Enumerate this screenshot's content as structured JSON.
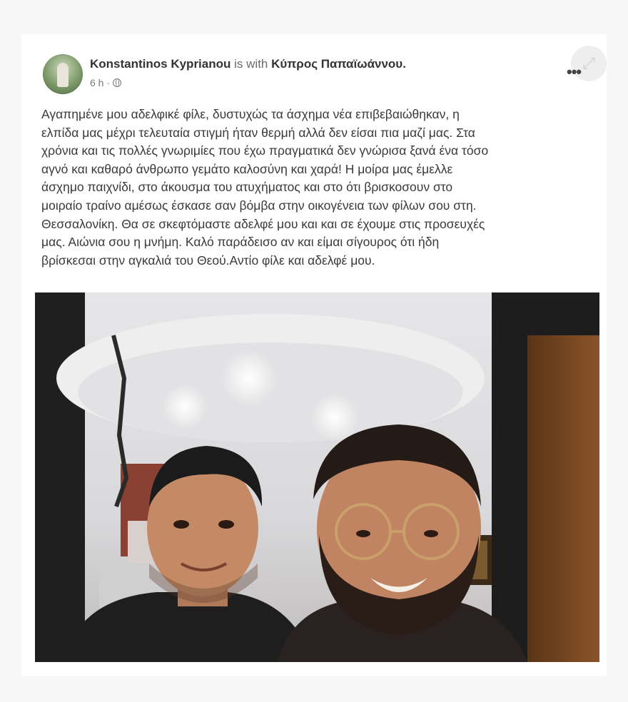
{
  "post": {
    "author": "Konstantinos Kyprianou",
    "with_text": "is with",
    "tagged": "Κύπρος Παπαϊωάννου.",
    "time": "6 h ·",
    "text": "Αγαπημένε μου αδελφικέ φίλε, δυστυχώς τα άσχημα νέα επιβεβαιώθηκαν, η\nελπίδα μας μέχρι τελευταία στιγμή ήταν θερμή αλλά δεν είσαι πια μαζί μας. Στα\nχρόνια και τις πολλές γνωριμίες που έχω πραγματικά δεν γνώρισα ξανά ένα τόσο\nαγνό και καθαρό άνθρωπο γεμάτο καλοσύνη και χαρά!  Η μοίρα μας έμελλε\nάσχημο παιχνίδι, στο άκουσμα του ατυχήματος και στο ότι βρισκοσουν στο\nμοιραίο τραίνο αμέσως έσκασε σαν βόμβα στην οικογένεια των φίλων σου στη.\nΘεσσαλονίκη. Θα σε σκεφτόμαστε αδελφέ μου και και σε έχουμε στις προσευχές\nμας. Αιώνια σου η μνήμη. Καλό παράδεισο αν και είμαι σίγουρος ότι ήδη\nβρίσκεσαι στην αγκαλιά του Θεού.Αντίο φίλε και αδελφέ μου."
  },
  "icons": {
    "privacy": "globe-icon",
    "more": "more-options-icon",
    "expand": "expand-icon"
  },
  "colors": {
    "text": "#3a3a3a",
    "name": "#333333",
    "meta": "#777777"
  }
}
